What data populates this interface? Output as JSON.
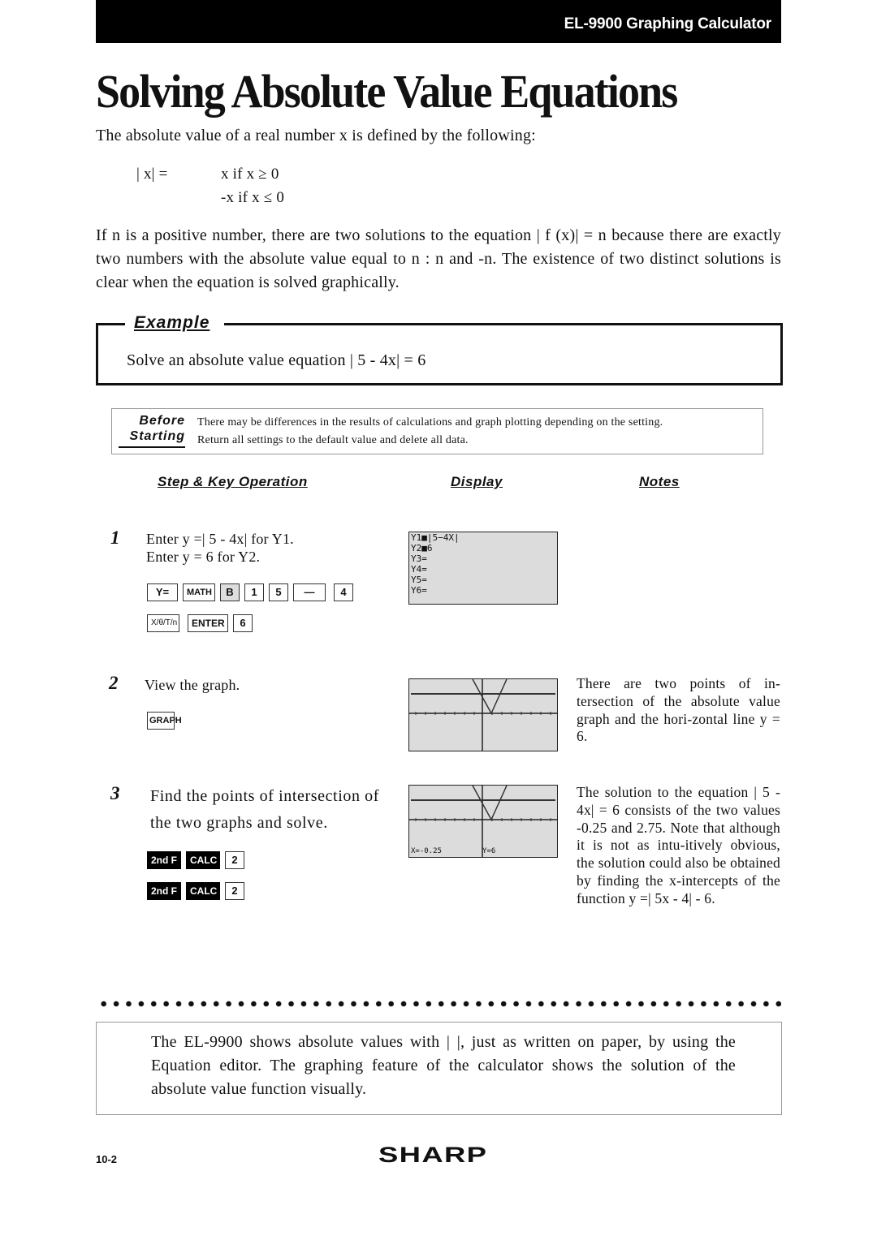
{
  "header": {
    "product": "EL-9900 Graphing Calculator"
  },
  "title": "Solving Absolute Value Equations",
  "intro": {
    "sentence": "The absolute value of a real number x is defined by the following:",
    "definition": {
      "lhs": "| x|  =",
      "case1": "x  if x ≥ 0",
      "case2": "-x  if x ≤ 0"
    },
    "paragraph": "If n is a positive number, there are two solutions to the equation | f (x)|  = n because there are exactly two numbers with the absolute value equal to n : n and -n. The existence of two distinct solutions is clear when the equation is solved graphically."
  },
  "example": {
    "label": "Example",
    "text": "Solve an absolute value equation | 5 - 4x|  = 6"
  },
  "before_starting": {
    "label_line1": "Before",
    "label_line2": "Starting",
    "line1": "There may be differences in the results of calculations and graph plotting depending on the setting.",
    "line2": "Return all settings to the default value and delete all data."
  },
  "columns": {
    "step": "Step & Key Operation",
    "display": "Display",
    "notes": "Notes"
  },
  "steps": [
    {
      "num": "1",
      "text_line1": "Enter y =| 5 - 4x|   for Y1.",
      "text_line2": "Enter y = 6 for Y2.",
      "keys_row1": [
        "Y=",
        "MATH",
        "B",
        "1",
        "5",
        "—",
        "4"
      ],
      "keys_row2": [
        "X/θ/T/n",
        "ENTER",
        "6"
      ],
      "screen_lines": [
        "Y1■|5−4X|",
        "Y2■6",
        "Y3=",
        "Y4=",
        "Y5=",
        "Y6="
      ],
      "notes": ""
    },
    {
      "num": "2",
      "text_line1": "View the graph.",
      "keys_row1": [
        "GRAPH"
      ],
      "notes": "There are two points of in-tersection of the absolute value graph and the hori-zontal line y = 6."
    },
    {
      "num": "3",
      "text_line1": "Find the points of intersection of",
      "text_line2": "the two graphs and solve.",
      "keys_row1": [
        "2nd F",
        "CALC",
        "2"
      ],
      "keys_row2": [
        "2nd F",
        "CALC",
        "2"
      ],
      "screen_readout_x": "X=-0.25",
      "screen_readout_y": "Y=6",
      "notes": "The solution to the equation | 5 - 4x| = 6 consists of the two values -0.25 and 2.75. Note that although it is not as intu-itively obvious, the solution could also be obtained by finding the x-intercepts of the function y =| 5x - 4|  - 6."
    }
  ],
  "summary": "The EL-9900 shows absolute values with |   |, just as written on paper, by using the Equation editor. The graphing feature of the calculator shows the solution of the absolute value function visually.",
  "footer": {
    "page_number": "10-2",
    "brand": "SHARP"
  }
}
